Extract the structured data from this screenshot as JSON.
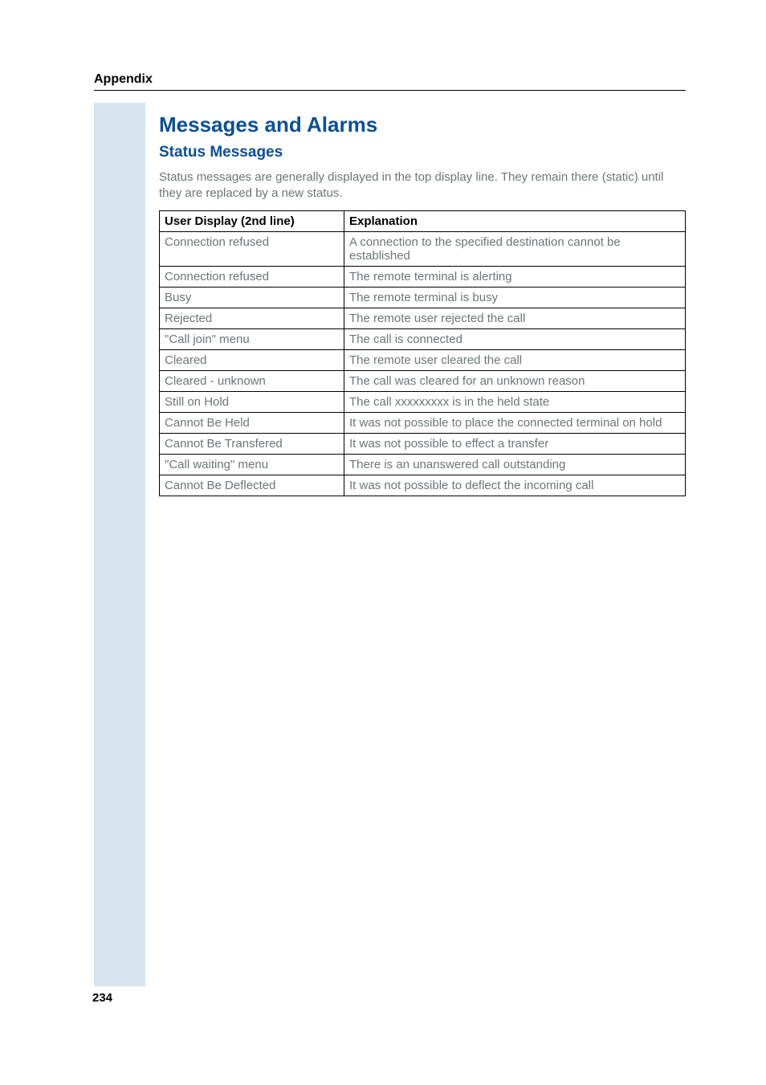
{
  "header": {
    "label": "Appendix"
  },
  "title": "Messages and Alarms",
  "subtitle": "Status Messages",
  "intro": "Status messages are generally displayed in the top display line. They remain there (static) until they are replaced by a new status.",
  "table": {
    "headers": [
      "User Display (2nd line)",
      "Explanation"
    ],
    "rows": [
      [
        "Connection refused",
        "A connection to the specified destination cannot be established"
      ],
      [
        "Connection refused",
        "The remote terminal is alerting"
      ],
      [
        "Busy",
        "The remote terminal is busy"
      ],
      [
        "Rejected",
        "The remote user rejected the call"
      ],
      [
        "\"Call join\" menu",
        "The call is connected"
      ],
      [
        "Cleared",
        "The remote user cleared the call"
      ],
      [
        "Cleared - unknown",
        "The call was cleared for an unknown reason"
      ],
      [
        "Still on Hold",
        "The call xxxxxxxxx is in the held state"
      ],
      [
        "Cannot Be Held",
        "It was not possible to place the connected terminal on hold"
      ],
      [
        "Cannot Be Transfered",
        "It was not possible to effect a transfer"
      ],
      [
        "\"Call waiting\" menu",
        "There is an unanswered call outstanding"
      ],
      [
        "Cannot Be Deflected",
        "It was not possible to deflect the incoming call"
      ]
    ]
  },
  "page_number": "234"
}
